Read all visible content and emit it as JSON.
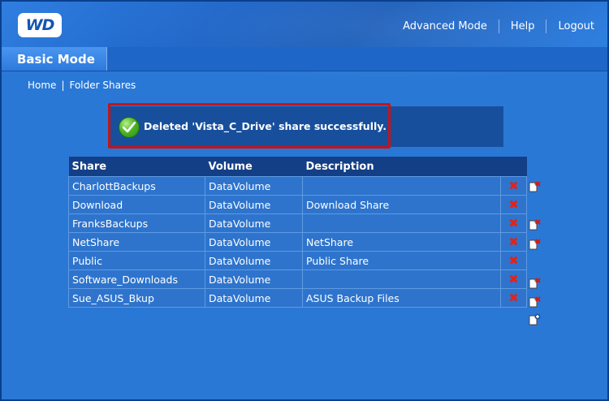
{
  "brand": {
    "logo_text": "WD"
  },
  "top_links": [
    "Advanced Mode",
    "Help",
    "Logout"
  ],
  "tab": {
    "label": "Basic Mode"
  },
  "breadcrumb": [
    "Home",
    "Folder Shares"
  ],
  "message": {
    "text": "Deleted 'Vista_C_Drive' share successfully."
  },
  "table": {
    "headers": [
      "Share",
      "Volume",
      "Description"
    ],
    "rows": [
      {
        "share": "CharlottBackups",
        "volume": "DataVolume",
        "description": "",
        "edit": true
      },
      {
        "share": "Download",
        "volume": "DataVolume",
        "description": "Download Share",
        "edit": false
      },
      {
        "share": "FranksBackups",
        "volume": "DataVolume",
        "description": "",
        "edit": true
      },
      {
        "share": "NetShare",
        "volume": "DataVolume",
        "description": "NetShare",
        "edit": true
      },
      {
        "share": "Public",
        "volume": "DataVolume",
        "description": "Public Share",
        "edit": false
      },
      {
        "share": "Software_Downloads",
        "volume": "DataVolume",
        "description": "",
        "edit": true
      },
      {
        "share": "Sue_ASUS_Bkup",
        "volume": "DataVolume",
        "description": "ASUS Backup Files",
        "edit": true
      }
    ]
  },
  "colors": {
    "accent": "#2a78d6",
    "header": "#133f86",
    "delete": "#e0241b",
    "highlight": "#c4141a"
  },
  "icons": {
    "success": "check-circle-icon",
    "delete": "delete-x-icon",
    "edit": "edit-share-icon",
    "add": "add-share-icon",
    "header": "user-access-icon"
  }
}
